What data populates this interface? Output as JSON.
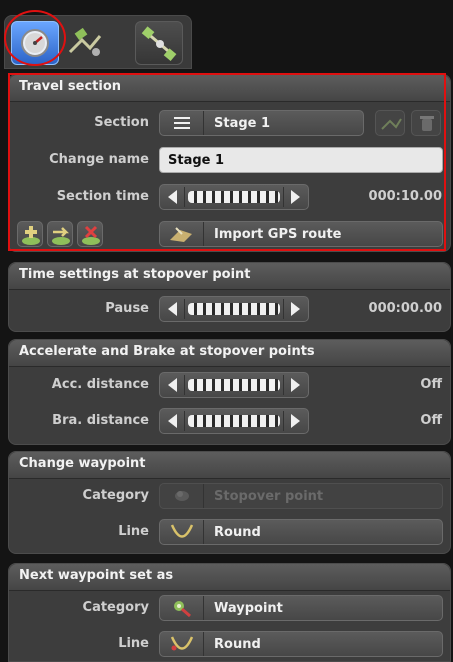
{
  "toolbar": {
    "tabs": [
      {
        "icon": "speedometer-icon",
        "active": true
      },
      {
        "icon": "route-icon",
        "active": false
      },
      {
        "icon": "satellite-icon",
        "active": false
      }
    ]
  },
  "travel_section": {
    "title": "Travel section",
    "section_label": "Section",
    "section_value": "Stage 1",
    "change_name_label": "Change name",
    "change_name_value": "Stage 1",
    "section_time_label": "Section time",
    "section_time_value": "000:10.00",
    "import_label": "Import GPS route"
  },
  "time_settings": {
    "title": "Time settings at stopover point",
    "pause_label": "Pause",
    "pause_value": "000:00.00"
  },
  "accel_brake": {
    "title": "Accelerate and Brake at stopover points",
    "acc_label": "Acc. distance",
    "acc_value": "Off",
    "bra_label": "Bra. distance",
    "bra_value": "Off"
  },
  "change_waypoint": {
    "title": "Change waypoint",
    "category_label": "Category",
    "category_value": "Stopover point",
    "line_label": "Line",
    "line_value": "Round"
  },
  "next_waypoint": {
    "title": "Next waypoint set as",
    "category_label": "Category",
    "category_value": "Waypoint",
    "line_label": "Line",
    "line_value": "Round"
  },
  "colors": {
    "highlight": "#e01010",
    "active_tab": "#2c64c8"
  }
}
